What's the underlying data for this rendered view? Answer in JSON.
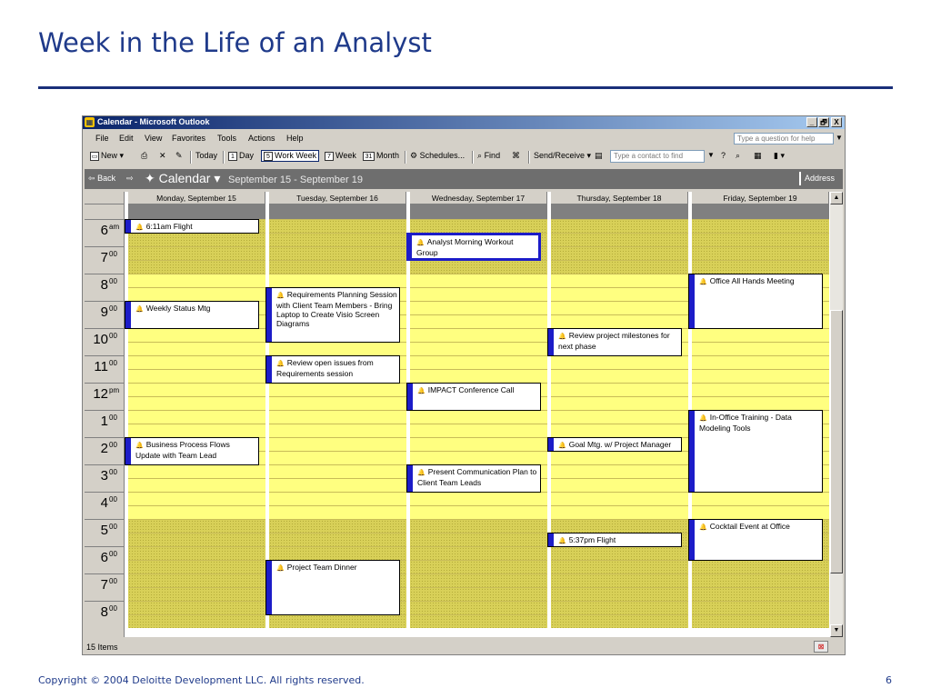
{
  "slide": {
    "title": "Week in the Life of an Analyst",
    "copyright": "Copyright © 2004 Deloitte Development LLC. All rights reserved.",
    "page_number": "6"
  },
  "window": {
    "title": "Calendar - Microsoft Outlook",
    "buttons": [
      "_",
      "🗗",
      "X"
    ]
  },
  "menubar": {
    "items": [
      "File",
      "Edit",
      "View",
      "Favorites",
      "Tools",
      "Actions",
      "Help"
    ],
    "question_placeholder": "Type a question for help"
  },
  "toolbar": {
    "new": "New",
    "today": "Today",
    "day": "Day",
    "work_week": "Work Week",
    "week": "Week",
    "month": "Month",
    "schedules": "Schedules...",
    "find": "Find",
    "send_receive": "Send/Receive",
    "contact_placeholder": "Type a contact to find",
    "day_icon": "1",
    "work_week_icon": "5",
    "week_icon": "7",
    "month_icon": "31"
  },
  "calendar_header": {
    "back": "Back",
    "title": "Calendar",
    "range": "September 15 - September 19",
    "address": "Address"
  },
  "days": [
    "Monday, September 15",
    "Tuesday, September 16",
    "Wednesday, September 17",
    "Thursday, September 18",
    "Friday, September 19"
  ],
  "hours": [
    {
      "h": "6",
      "m": "am"
    },
    {
      "h": "7",
      "m": "00"
    },
    {
      "h": "8",
      "m": "00"
    },
    {
      "h": "9",
      "m": "00"
    },
    {
      "h": "10",
      "m": "00"
    },
    {
      "h": "11",
      "m": "00"
    },
    {
      "h": "12",
      "m": "pm"
    },
    {
      "h": "1",
      "m": "00"
    },
    {
      "h": "2",
      "m": "00"
    },
    {
      "h": "3",
      "m": "00"
    },
    {
      "h": "4",
      "m": "00"
    },
    {
      "h": "5",
      "m": "00"
    },
    {
      "h": "6",
      "m": "00"
    },
    {
      "h": "7",
      "m": "00"
    },
    {
      "h": "8",
      "m": "00"
    }
  ],
  "work_hours": {
    "start": 8,
    "end": 17
  },
  "appointments": [
    {
      "day": 0,
      "start": 6.0,
      "end": 6.5,
      "text": "6:11am Flight"
    },
    {
      "day": 0,
      "start": 9.0,
      "end": 10.0,
      "text": "Weekly Status Mtg"
    },
    {
      "day": 0,
      "start": 14.0,
      "end": 15.0,
      "text": "Business Process Flows Update with Team Lead"
    },
    {
      "day": 1,
      "start": 8.5,
      "end": 10.5,
      "text": "Requirements Planning Session with Client Team Members - Bring Laptop to Create Visio Screen Diagrams"
    },
    {
      "day": 1,
      "start": 11.0,
      "end": 12.0,
      "text": "Review open issues from Requirements session"
    },
    {
      "day": 1,
      "start": 18.5,
      "end": 20.5,
      "text": "Project Team Dinner"
    },
    {
      "day": 2,
      "start": 6.5,
      "end": 7.5,
      "text": "Analyst Morning Workout Group",
      "selected": true
    },
    {
      "day": 2,
      "start": 12.0,
      "end": 13.0,
      "text": "IMPACT Conference Call"
    },
    {
      "day": 2,
      "start": 15.0,
      "end": 16.0,
      "text": "Present Communication Plan to Client Team Leads"
    },
    {
      "day": 3,
      "start": 10.0,
      "end": 11.0,
      "text": "Review project milestones for next phase"
    },
    {
      "day": 3,
      "start": 14.0,
      "end": 14.5,
      "text": "Goal Mtg. w/ Project Manager"
    },
    {
      "day": 3,
      "start": 17.5,
      "end": 18.0,
      "text": "5:37pm Flight"
    },
    {
      "day": 4,
      "start": 8.0,
      "end": 10.0,
      "text": "Office All Hands Meeting"
    },
    {
      "day": 4,
      "start": 13.0,
      "end": 16.0,
      "text": "In-Office Training - Data Modeling Tools"
    },
    {
      "day": 4,
      "start": 17.0,
      "end": 18.5,
      "text": "Cocktail Event at Office"
    }
  ],
  "status": {
    "items": "15 Items"
  }
}
